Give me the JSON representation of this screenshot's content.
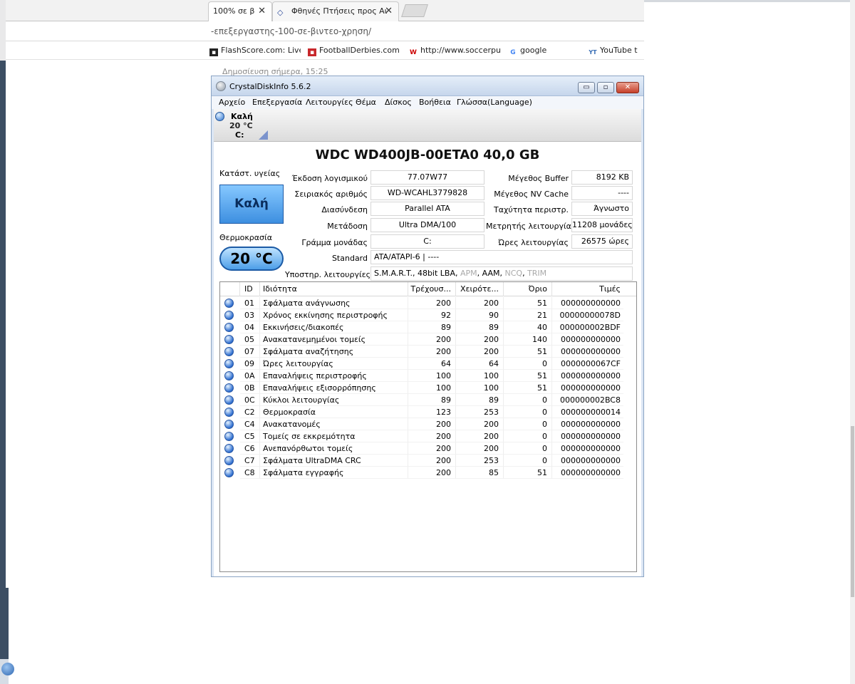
{
  "browser": {
    "tabs": [
      {
        "label": "100% σε β",
        "close": "✕"
      },
      {
        "label": "Φθηνές Πτήσεις προς Αι",
        "close": "✕"
      }
    ],
    "address": "-επεξεργαστης-100-σε-βιντεο-χρηση/",
    "bookmarks": [
      {
        "label": "FlashScore.com: Live S",
        "icon": "flashscore-icon"
      },
      {
        "label": "FootballDerbies.com",
        "icon": "footballderbies-icon"
      },
      {
        "label": "http://www.soccerpun",
        "icon": "soccerpunter-icon"
      },
      {
        "label": "google",
        "icon": "google-icon"
      },
      {
        "label": "YouTube t",
        "icon": "youtube-mp3-icon"
      }
    ],
    "page_text": "Δημοσίευση σήμερα, 15:25"
  },
  "app": {
    "title": "CrystalDiskInfo 5.6.2",
    "window_buttons": {
      "minimize": "▭",
      "maximize": "▫",
      "close": "✕"
    },
    "menu": [
      "Αρχείο",
      "Επεξεργασία",
      "Λειτουργίες",
      "Θέμα",
      "Δίσκος",
      "Βοήθεια",
      "Γλώσσα(Language)"
    ],
    "disk_tab": {
      "status": "Καλή",
      "temp": "20 °C",
      "letter": "C:"
    },
    "model": "WDC WD400JB-00ETA0  40,0 GB",
    "health_label": "Κατάστ. υγείας",
    "health_value": "Καλή",
    "temp_label": "Θερμοκρασία",
    "temp_value": "20 °C",
    "fields_left": [
      {
        "label": "Έκδοση λογισμικού",
        "value": "77.07W77"
      },
      {
        "label": "Σειριακός αριθμός",
        "value": "WD-WCAHL3779828"
      },
      {
        "label": "Διασύνδεση",
        "value": "Parallel ATA"
      },
      {
        "label": "Μετάδοση",
        "value": "Ultra DMA/100"
      },
      {
        "label": "Γράμμα μονάδας",
        "value": "C:"
      }
    ],
    "fields_right": [
      {
        "label": "Μέγεθος Buffer",
        "value": "8192 KB"
      },
      {
        "label": "Μέγεθος NV Cache",
        "value": "----"
      },
      {
        "label": "Ταχύτητα περιστρ.",
        "value": "Άγνωστο"
      },
      {
        "label": "Μετρητής λειτουργίας",
        "value": "11208 μονάδες"
      },
      {
        "label": "Ώρες λειτουργίας",
        "value": "26575 ώρες"
      }
    ],
    "standard": {
      "label": "Standard",
      "value": "ATA/ATAPI-6 | ----"
    },
    "features": {
      "label": "Υποστηρ. λειτουργίες",
      "active": "S.M.A.R.T., 48bit LBA, ",
      "apm": "APM",
      "sep1": ", AAM, ",
      "ncq": "NCQ",
      "sep2": ", ",
      "trim": "TRIM"
    },
    "smart": {
      "columns": [
        "ID",
        "Ιδιότητα",
        "Τρέχουσ...",
        "Χειρότε...",
        "Όριο",
        "Τιμές"
      ],
      "rows": [
        {
          "id": "01",
          "attr": "Σφάλματα ανάγνωσης",
          "cur": "200",
          "worst": "200",
          "thr": "51",
          "raw": "000000000000"
        },
        {
          "id": "03",
          "attr": "Χρόνος εκκίνησης περιστροφής",
          "cur": "92",
          "worst": "90",
          "thr": "21",
          "raw": "00000000078D"
        },
        {
          "id": "04",
          "attr": "Εκκινήσεις/διακοπές",
          "cur": "89",
          "worst": "89",
          "thr": "40",
          "raw": "000000002BDF"
        },
        {
          "id": "05",
          "attr": "Ανακατανεμημένοι τομείς",
          "cur": "200",
          "worst": "200",
          "thr": "140",
          "raw": "000000000000"
        },
        {
          "id": "07",
          "attr": "Σφάλματα αναζήτησης",
          "cur": "200",
          "worst": "200",
          "thr": "51",
          "raw": "000000000000"
        },
        {
          "id": "09",
          "attr": "Ώρες λειτουργίας",
          "cur": "64",
          "worst": "64",
          "thr": "0",
          "raw": "0000000067CF"
        },
        {
          "id": "0A",
          "attr": "Επαναλήψεις περιστροφής",
          "cur": "100",
          "worst": "100",
          "thr": "51",
          "raw": "000000000000"
        },
        {
          "id": "0B",
          "attr": "Επαναλήψεις εξισορρόπησης",
          "cur": "100",
          "worst": "100",
          "thr": "51",
          "raw": "000000000000"
        },
        {
          "id": "0C",
          "attr": "Κύκλοι λειτουργίας",
          "cur": "89",
          "worst": "89",
          "thr": "0",
          "raw": "000000002BC8"
        },
        {
          "id": "C2",
          "attr": "Θερμοκρασία",
          "cur": "123",
          "worst": "253",
          "thr": "0",
          "raw": "000000000014"
        },
        {
          "id": "C4",
          "attr": "Ανακατανομές",
          "cur": "200",
          "worst": "200",
          "thr": "0",
          "raw": "000000000000"
        },
        {
          "id": "C5",
          "attr": "Τομείς σε εκκρεμότητα",
          "cur": "200",
          "worst": "200",
          "thr": "0",
          "raw": "000000000000"
        },
        {
          "id": "C6",
          "attr": "Ανεπανόρθωτοι τομείς",
          "cur": "200",
          "worst": "200",
          "thr": "0",
          "raw": "000000000000"
        },
        {
          "id": "C7",
          "attr": "Σφάλματα UltraDMA CRC",
          "cur": "200",
          "worst": "253",
          "thr": "0",
          "raw": "000000000000"
        },
        {
          "id": "C8",
          "attr": "Σφάλματα εγγραφής",
          "cur": "200",
          "worst": "85",
          "thr": "51",
          "raw": "000000000000"
        }
      ]
    }
  },
  "colors": {
    "health_good": "#3d8fe0",
    "status_orb": "#2f6fd0"
  }
}
